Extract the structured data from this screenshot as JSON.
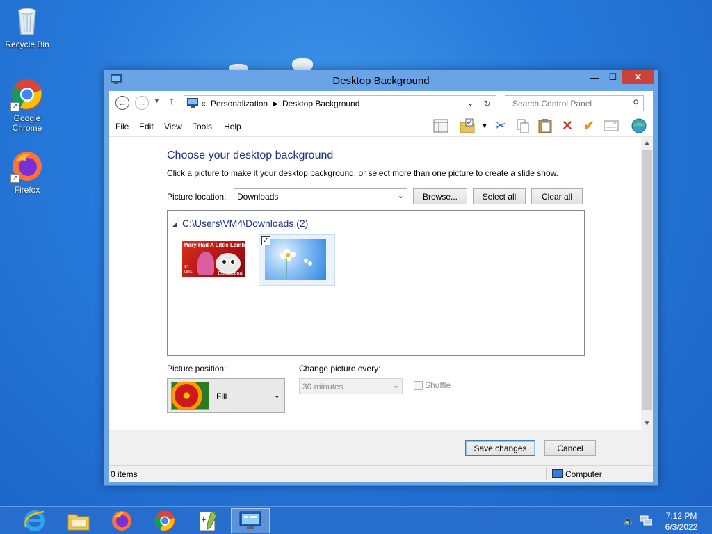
{
  "desktop": {
    "icons": [
      {
        "label": "Recycle Bin",
        "icon": "recycle-bin-icon"
      },
      {
        "label": "Google Chrome",
        "icon": "chrome-icon"
      },
      {
        "label": "Firefox",
        "icon": "firefox-icon"
      }
    ]
  },
  "window": {
    "title": "Desktop Background",
    "controls": {
      "minimize": "—",
      "maximize": "☐",
      "close": "✕"
    }
  },
  "address": {
    "prefix": "«",
    "crumbs": [
      "Personalization",
      "Desktop Background"
    ],
    "search_placeholder": "Search Control Panel"
  },
  "menu": {
    "items": [
      "File",
      "Edit",
      "View",
      "Tools",
      "Help"
    ]
  },
  "toolbar": {
    "icons": [
      "layout-icon",
      "properties-icon",
      "cut-icon",
      "copy-icon",
      "paste-icon",
      "delete-icon",
      "undo-icon",
      "email-icon",
      "globe-icon"
    ]
  },
  "page": {
    "heading": "Choose your desktop background",
    "subtext": "Click a picture to make it your desktop background, or select more than one picture to create a slide show.",
    "picture_location_label": "Picture location:",
    "picture_location_value": "Downloads",
    "browse_label": "Browse...",
    "select_all_label": "Select all",
    "clear_all_label": "Clear all",
    "group_header": "C:\\Users\\VM4\\Downloads (2)",
    "thumbnails": [
      {
        "caption": "Mary Had A Little Lamb",
        "badge_left": "90 Mins",
        "badge_right": "Educational",
        "checked": false
      },
      {
        "caption": "",
        "checked": true
      }
    ],
    "picture_position_label": "Picture position:",
    "picture_position_value": "Fill",
    "change_every_label": "Change picture every:",
    "change_every_value": "30 minutes",
    "shuffle_label": "Shuffle"
  },
  "footer": {
    "save_label": "Save changes",
    "cancel_label": "Cancel"
  },
  "status": {
    "items_text": "0 items",
    "location_text": "Computer"
  },
  "taskbar": {
    "apps": [
      "internet-explorer-icon",
      "file-explorer-icon",
      "firefox-icon",
      "chrome-icon",
      "notepadpp-icon",
      "control-panel-icon"
    ],
    "time": "7:12 PM",
    "date": "6/3/2022"
  },
  "colors": {
    "accent_blue": "#1e3287",
    "close_red": "#c7443c",
    "desktop_blue": "#2578d9"
  }
}
